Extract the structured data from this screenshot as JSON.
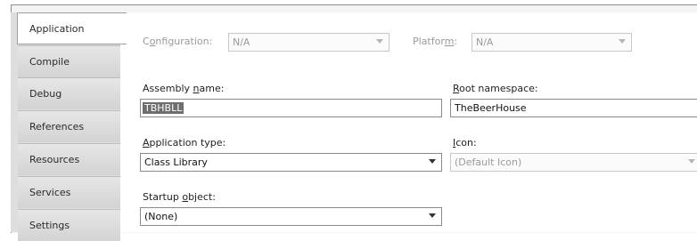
{
  "tabs": [
    {
      "label": "Application",
      "active": true
    },
    {
      "label": "Compile"
    },
    {
      "label": "Debug"
    },
    {
      "label": "References"
    },
    {
      "label": "Resources"
    },
    {
      "label": "Services"
    },
    {
      "label": "Settings"
    }
  ],
  "toolbar": {
    "configuration_label_pre": "C",
    "configuration_label_u": "o",
    "configuration_label_post": "nfiguration:",
    "configuration_value": "N/A",
    "platform_label_pre": "Platfor",
    "platform_label_u": "m",
    "platform_label_post": ":",
    "platform_value": "N/A"
  },
  "assembly_name": {
    "label_pre": "Assembly ",
    "label_u": "n",
    "label_post": "ame:",
    "value": "TBHBLL"
  },
  "root_namespace": {
    "label_u": "R",
    "label_post": "oot namespace:",
    "value": "TheBeerHouse"
  },
  "application_type": {
    "label_u": "A",
    "label_post": "pplication type:",
    "value": "Class Library"
  },
  "icon": {
    "label_u": "I",
    "label_post": "con:",
    "value": "(Default Icon)"
  },
  "startup_object": {
    "label_pre": "Startup ",
    "label_u": "o",
    "label_post": "bject:",
    "value": "(None)"
  }
}
